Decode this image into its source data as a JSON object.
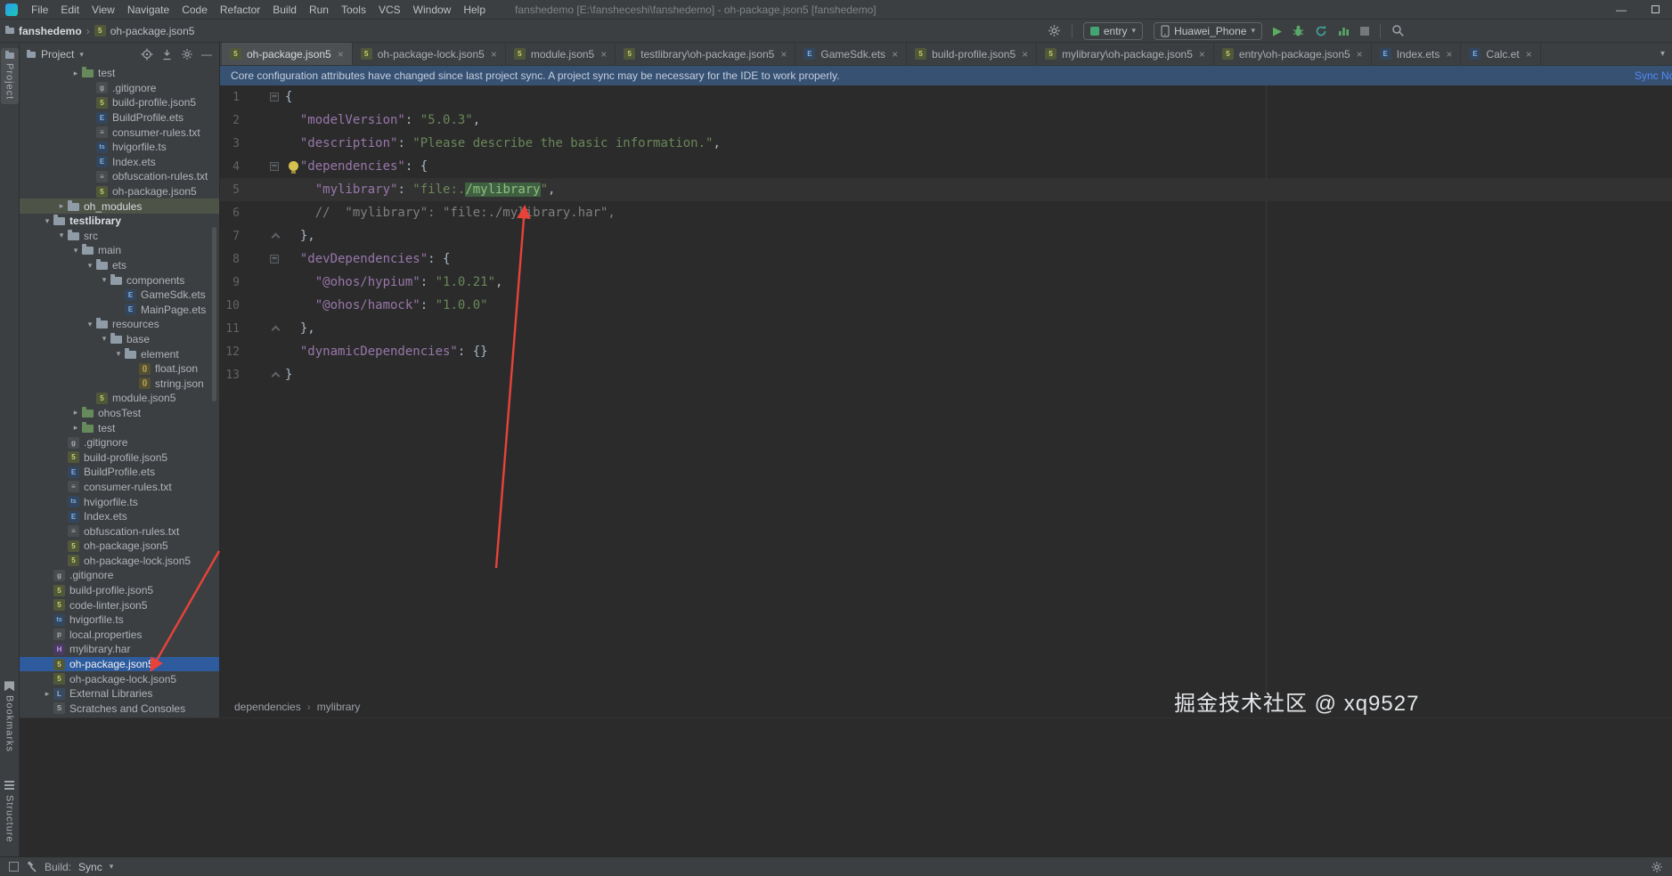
{
  "colors": {
    "annotation_red": "#e8433a",
    "selection_blue": "#2e5b9d",
    "soft_selection": "#4e5348",
    "key_purple": "#9876aa",
    "string_green": "#6a8759",
    "banner_blue": "#375173"
  },
  "window": {
    "menus": [
      "File",
      "Edit",
      "View",
      "Navigate",
      "Code",
      "Refactor",
      "Build",
      "Run",
      "Tools",
      "VCS",
      "Window",
      "Help"
    ],
    "title": "fanshedemo [E:\\fansheceshi\\fanshedemo] - oh-package.json5 [fanshedemo]"
  },
  "navbar": {
    "project": "fanshedemo",
    "file": "oh-package.json5",
    "run_config": "entry",
    "device": "Huawei_Phone"
  },
  "stripe": {
    "top": [
      "Project"
    ],
    "bottom": [
      "Bookmarks",
      "Structure"
    ]
  },
  "project": {
    "title": "Project",
    "tree": [
      {
        "label": "test",
        "depth": 3,
        "icon": "folder-test",
        "state": "closed"
      },
      {
        "label": ".gitignore",
        "depth": 4,
        "icon": "file-git"
      },
      {
        "label": "build-profile.json5",
        "depth": 4,
        "icon": "file-json5"
      },
      {
        "label": "BuildProfile.ets",
        "depth": 4,
        "icon": "file-ets"
      },
      {
        "label": "consumer-rules.txt",
        "depth": 4,
        "icon": "file-txt"
      },
      {
        "label": "hvigorfile.ts",
        "depth": 4,
        "icon": "file-ts"
      },
      {
        "label": "Index.ets",
        "depth": 4,
        "icon": "file-ets"
      },
      {
        "label": "obfuscation-rules.txt",
        "depth": 4,
        "icon": "file-txt"
      },
      {
        "label": "oh-package.json5",
        "depth": 4,
        "icon": "file-json5"
      },
      {
        "label": "oh_modules",
        "depth": 2,
        "icon": "folder",
        "state": "closed",
        "sel": "soft"
      },
      {
        "label": "testlibrary",
        "depth": 1,
        "icon": "folder",
        "state": "open",
        "bold": true
      },
      {
        "label": "src",
        "depth": 2,
        "icon": "folder",
        "state": "open"
      },
      {
        "label": "main",
        "depth": 3,
        "icon": "folder",
        "state": "open"
      },
      {
        "label": "ets",
        "depth": 4,
        "icon": "folder",
        "state": "open"
      },
      {
        "label": "components",
        "depth": 5,
        "icon": "folder",
        "state": "open"
      },
      {
        "label": "GameSdk.ets",
        "depth": 6,
        "icon": "file-ets"
      },
      {
        "label": "MainPage.ets",
        "depth": 6,
        "icon": "file-ets"
      },
      {
        "label": "resources",
        "depth": 4,
        "icon": "folder",
        "state": "open"
      },
      {
        "label": "base",
        "depth": 5,
        "icon": "folder",
        "state": "open"
      },
      {
        "label": "element",
        "depth": 6,
        "icon": "folder",
        "state": "open"
      },
      {
        "label": "float.json",
        "depth": 7,
        "icon": "file-json"
      },
      {
        "label": "string.json",
        "depth": 7,
        "icon": "file-json"
      },
      {
        "label": "module.json5",
        "depth": 4,
        "icon": "file-json5"
      },
      {
        "label": "ohosTest",
        "depth": 3,
        "icon": "folder-test",
        "state": "closed"
      },
      {
        "label": "test",
        "depth": 3,
        "icon": "folder-test",
        "state": "closed"
      },
      {
        "label": ".gitignore",
        "depth": 2,
        "icon": "file-git"
      },
      {
        "label": "build-profile.json5",
        "depth": 2,
        "icon": "file-json5"
      },
      {
        "label": "BuildProfile.ets",
        "depth": 2,
        "icon": "file-ets"
      },
      {
        "label": "consumer-rules.txt",
        "depth": 2,
        "icon": "file-txt"
      },
      {
        "label": "hvigorfile.ts",
        "depth": 2,
        "icon": "file-ts"
      },
      {
        "label": "Index.ets",
        "depth": 2,
        "icon": "file-ets"
      },
      {
        "label": "obfuscation-rules.txt",
        "depth": 2,
        "icon": "file-txt"
      },
      {
        "label": "oh-package.json5",
        "depth": 2,
        "icon": "file-json5"
      },
      {
        "label": "oh-package-lock.json5",
        "depth": 2,
        "icon": "file-json5"
      },
      {
        "label": ".gitignore",
        "depth": 1,
        "icon": "file-git"
      },
      {
        "label": "build-profile.json5",
        "depth": 1,
        "icon": "file-json5"
      },
      {
        "label": "code-linter.json5",
        "depth": 1,
        "icon": "file-json5"
      },
      {
        "label": "hvigorfile.ts",
        "depth": 1,
        "icon": "file-ts"
      },
      {
        "label": "local.properties",
        "depth": 1,
        "icon": "file-prop"
      },
      {
        "label": "mylibrary.har",
        "depth": 1,
        "icon": "file-har"
      },
      {
        "label": "oh-package.json5",
        "depth": 1,
        "icon": "file-json5",
        "sel": "blue"
      },
      {
        "label": "oh-package-lock.json5",
        "depth": 1,
        "icon": "file-json5"
      },
      {
        "label": "External Libraries",
        "depth": 1,
        "icon": "lib",
        "state": "closed"
      },
      {
        "label": "Scratches and Consoles",
        "depth": 1,
        "icon": "scratch"
      }
    ]
  },
  "tabs": [
    {
      "label": "oh-package.json5",
      "icon": "file-json5",
      "active": true
    },
    {
      "label": "oh-package-lock.json5",
      "icon": "file-json5"
    },
    {
      "label": "module.json5",
      "icon": "file-json5"
    },
    {
      "label": "testlibrary\\oh-package.json5",
      "icon": "file-json5"
    },
    {
      "label": "GameSdk.ets",
      "icon": "file-ets"
    },
    {
      "label": "build-profile.json5",
      "icon": "file-json5"
    },
    {
      "label": "mylibrary\\oh-package.json5",
      "icon": "file-json5"
    },
    {
      "label": "entry\\oh-package.json5",
      "icon": "file-json5"
    },
    {
      "label": "Index.ets",
      "icon": "file-ets"
    },
    {
      "label": "Calc.et",
      "icon": "file-ets"
    }
  ],
  "banner": {
    "text": "Core configuration attributes have changed since last project sync. A project sync may be necessary for the IDE to work properly.",
    "action": "Sync Now"
  },
  "code": {
    "lines": [
      {
        "n": 1,
        "fold": "open",
        "toks": [
          [
            "{",
            "p"
          ]
        ]
      },
      {
        "n": 2,
        "toks": [
          [
            "  ",
            "p"
          ],
          [
            "\"modelVersion\"",
            "k"
          ],
          [
            ": ",
            "p"
          ],
          [
            "\"5.0.3\"",
            "s"
          ],
          [
            ",",
            "p"
          ]
        ]
      },
      {
        "n": 3,
        "toks": [
          [
            "  ",
            "p"
          ],
          [
            "\"description\"",
            "k"
          ],
          [
            ": ",
            "p"
          ],
          [
            "\"Please describe the basic information.\"",
            "s"
          ],
          [
            ",",
            "p"
          ]
        ]
      },
      {
        "n": 4,
        "fold": "open",
        "bulb": true,
        "toks": [
          [
            "  ",
            "p"
          ],
          [
            "\"dependencies\"",
            "k"
          ],
          [
            ": {",
            "p"
          ]
        ]
      },
      {
        "n": 5,
        "cur": true,
        "toks": [
          [
            "    ",
            "p"
          ],
          [
            "\"mylibrary\"",
            "k"
          ],
          [
            ": ",
            "p"
          ],
          [
            "\"file:.",
            "s"
          ],
          [
            "/mylibrary",
            "shl"
          ],
          [
            "\"",
            "s"
          ],
          [
            ",",
            "p"
          ]
        ]
      },
      {
        "n": 6,
        "toks": [
          [
            "    //  \"mylibrary\": \"file:./mylibrary.har\",",
            "c"
          ]
        ]
      },
      {
        "n": 7,
        "fold": "end",
        "toks": [
          [
            "  },",
            "p"
          ]
        ]
      },
      {
        "n": 8,
        "fold": "open",
        "toks": [
          [
            "  ",
            "p"
          ],
          [
            "\"devDependencies\"",
            "k"
          ],
          [
            ": {",
            "p"
          ]
        ]
      },
      {
        "n": 9,
        "toks": [
          [
            "    ",
            "p"
          ],
          [
            "\"@ohos/hypium\"",
            "k"
          ],
          [
            ": ",
            "p"
          ],
          [
            "\"1.0.21\"",
            "s"
          ],
          [
            ",",
            "p"
          ]
        ]
      },
      {
        "n": 10,
        "toks": [
          [
            "    ",
            "p"
          ],
          [
            "\"@ohos/hamock\"",
            "k"
          ],
          [
            ": ",
            "p"
          ],
          [
            "\"1.0.0\"",
            "s"
          ]
        ]
      },
      {
        "n": 11,
        "fold": "end",
        "toks": [
          [
            "  },",
            "p"
          ]
        ]
      },
      {
        "n": 12,
        "toks": [
          [
            "  ",
            "p"
          ],
          [
            "\"dynamicDependencies\"",
            "k"
          ],
          [
            ": {}",
            "p"
          ]
        ]
      },
      {
        "n": 13,
        "fold": "end",
        "toks": [
          [
            "}",
            "p"
          ]
        ]
      }
    ],
    "breadcrumbs": [
      "dependencies",
      "mylibrary"
    ]
  },
  "statusbar": {
    "label": "Build:",
    "value": "Sync"
  },
  "watermark": "掘金技术社区 @ xq9527"
}
